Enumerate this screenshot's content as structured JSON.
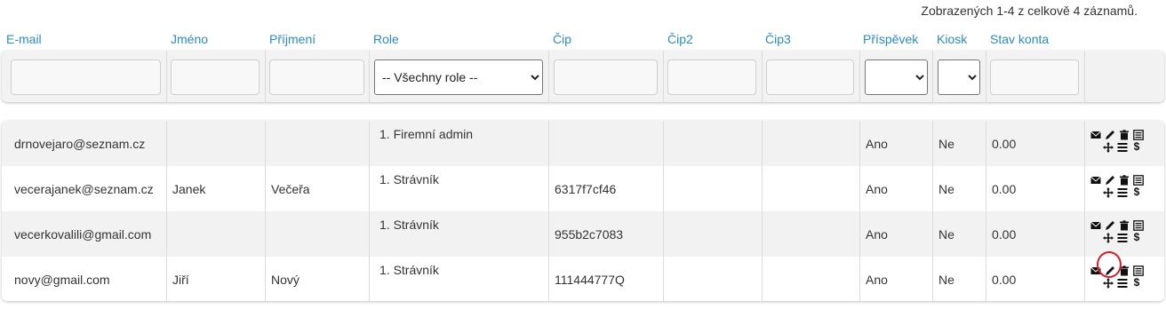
{
  "summary": "Zobrazených 1-4 z celkově 4 záznamů.",
  "columns": {
    "email": "E-mail",
    "first_name": "Jméno",
    "last_name": "Příjmení",
    "role": "Role",
    "chip": "Čip",
    "chip2": "Čip2",
    "chip3": "Čip3",
    "contribution": "Příspěvek",
    "kiosk": "Kiosk",
    "balance": "Stav konta"
  },
  "filters": {
    "role_selected": "-- Všechny role --",
    "contribution_selected": "",
    "kiosk_selected": ""
  },
  "rows": [
    {
      "email": "drnovejaro@seznam.cz",
      "first_name": "",
      "last_name": "",
      "role": "1. Firemní admin",
      "chip": "",
      "chip2": "",
      "chip3": "",
      "contribution": "Ano",
      "kiosk": "Ne",
      "balance": "0.00"
    },
    {
      "email": "vecerajanek@seznam.cz",
      "first_name": "Janek",
      "last_name": "Večeřa",
      "role": "1. Strávník",
      "chip": "6317f7cf46",
      "chip2": "",
      "chip3": "",
      "contribution": "Ano",
      "kiosk": "Ne",
      "balance": "0.00"
    },
    {
      "email": "vecerkovalili@gmail.com",
      "first_name": "",
      "last_name": "",
      "role": "1. Strávník",
      "chip": "955b2c7083",
      "chip2": "",
      "chip3": "",
      "contribution": "Ano",
      "kiosk": "Ne",
      "balance": "0.00"
    },
    {
      "email": "novy@gmail.com",
      "first_name": "Jiří",
      "last_name": "Nový",
      "role": "1. Strávník",
      "chip": "111444777Q",
      "chip2": "",
      "chip3": "",
      "contribution": "Ano",
      "kiosk": "Ne",
      "balance": "0.00"
    }
  ],
  "action_icons": [
    "envelope-icon",
    "pencil-icon",
    "trash-icon",
    "list-alt-icon",
    "move-icon",
    "menu-lines-icon",
    "dollar-icon"
  ],
  "dollar_glyph": "$"
}
